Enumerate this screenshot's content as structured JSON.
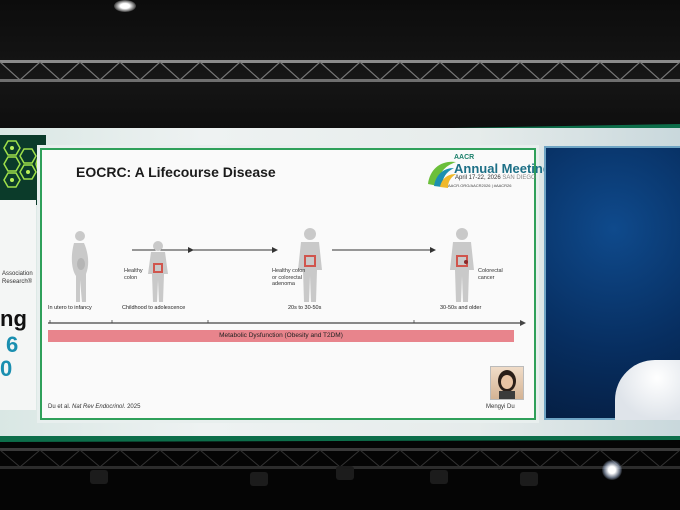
{
  "slide": {
    "title": "EOCRC: A Lifecourse Disease",
    "logo": {
      "org": "AACR",
      "event": "Annual Meeting",
      "dates": "April 17-22, 2026",
      "location": "SAN DIEGO",
      "hashtag": "AACR.ORG/AACR2026 | #AACR26"
    },
    "figures": [
      {
        "label": "",
        "stage": "In utero to infancy"
      },
      {
        "label": "Healthy colon",
        "stage": "Childhood to adolescence"
      },
      {
        "label": "Healthy colon or colorectal adenoma",
        "stage": "20s to 30-50s"
      },
      {
        "label": "Colorectal cancer",
        "stage": "30-50s and older"
      }
    ],
    "band_label": "Metabolic Dysfunction (Obesity and T2DM)",
    "citation_authors": "Du et al.",
    "citation_journal": "Nat Rev Endocrinol.",
    "citation_year": "2025",
    "presenter": "Mengyi Du"
  },
  "left_panel": {
    "org_line1": "Association",
    "org_line2": "Research®",
    "word_fragment": "ng",
    "year_fragment_1": "6",
    "year_fragment_2": "0"
  },
  "colors": {
    "accent_green": "#2fa05a",
    "band_pink": "#e8848c",
    "brand_teal": "#1c6f86",
    "camera_blue": "#0f4a8c"
  }
}
